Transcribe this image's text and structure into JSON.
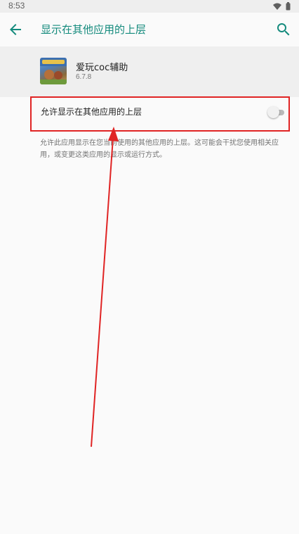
{
  "status_bar": {
    "time": "8:53",
    "icons": [
      "wifi-icon",
      "battery-icon"
    ]
  },
  "toolbar": {
    "title": "显示在其他应用的上层",
    "back_icon": "arrow-left-icon",
    "search_icon": "search-icon"
  },
  "app": {
    "name": "爱玩coc辅助",
    "version": "6.7.8"
  },
  "setting": {
    "label": "允许显示在其他应用的上层",
    "enabled": false,
    "description": "允许此应用显示在您当前使用的其他应用的上层。这可能会干扰您使用相关应用，或变更这类应用的显示或运行方式。"
  },
  "colors": {
    "accent": "#138a7c",
    "annotation": "#e02424",
    "background": "#fafafa",
    "header_bg": "#efefef"
  }
}
